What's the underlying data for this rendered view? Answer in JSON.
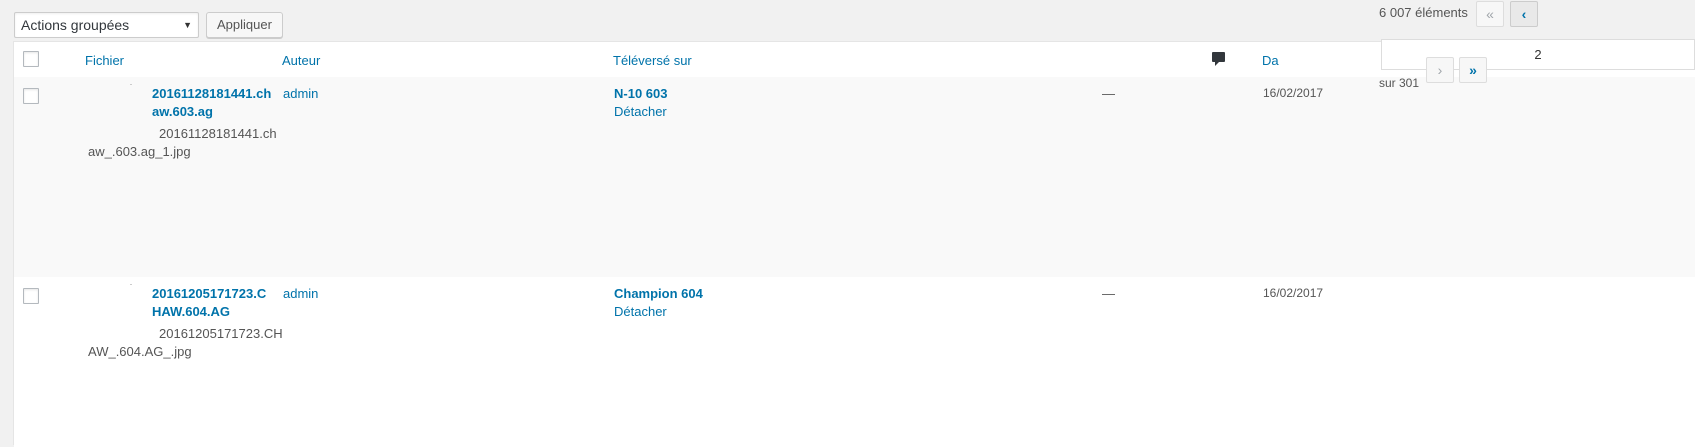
{
  "tablenav": {
    "bulk_actions_label": "Actions groupées",
    "apply_label": "Appliquer",
    "displaying_num": "6 007 éléments",
    "first_page": "«",
    "prev_page": "‹",
    "next_page": "›",
    "last_page": "»",
    "current_page": "2",
    "total_pages_text": "sur 301"
  },
  "columns": {
    "file": "Fichier",
    "author": "Auteur",
    "uploaded_to": "Téléversé sur",
    "comments_icon": "comment-icon",
    "date": "Da"
  },
  "rows": [
    {
      "title": "20161128181441.chaw.603.ag",
      "filename": "20161128181441.chaw_.603.ag_1.jpg",
      "author": "admin",
      "parent": "N-10 603",
      "detach": "Détacher",
      "comments": "—",
      "date": "16/02/2017"
    },
    {
      "title": "20161205171723.CHAW.604.AG",
      "filename": "20161205171723.CHAW_.604.AG_.jpg",
      "author": "admin",
      "parent": "Champion 604",
      "detach": "Détacher",
      "comments": "—",
      "date": "16/02/2017"
    }
  ],
  "colors": {
    "link": "#0073aa",
    "background": "#f1f1f1",
    "row_alt": "#f9f9f9"
  }
}
